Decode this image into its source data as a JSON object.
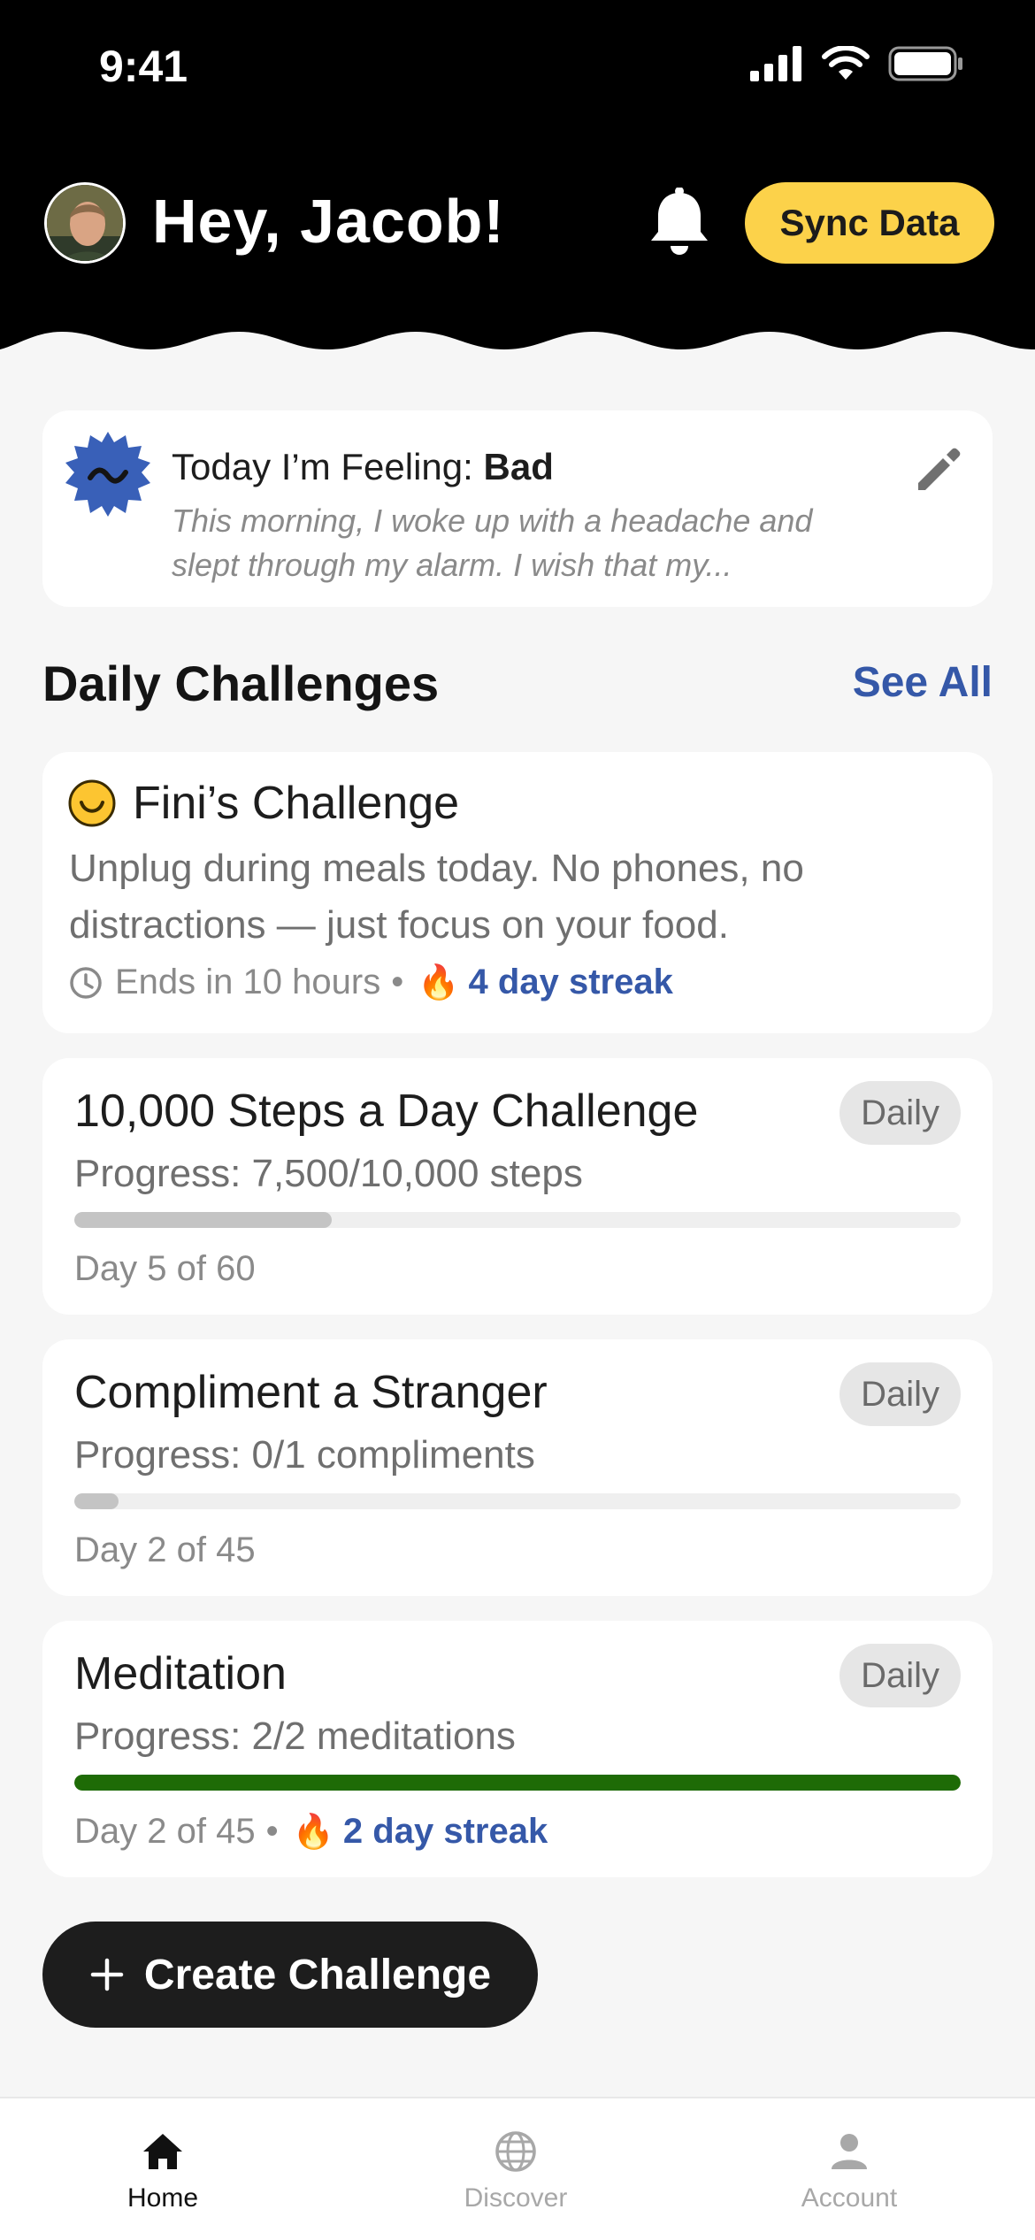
{
  "status_bar": {
    "time": "9:41"
  },
  "header": {
    "greeting": "Hey, Jacob!",
    "sync_label": "Sync Data"
  },
  "feeling": {
    "prefix": "Today I’m Feeling: ",
    "mood": "Bad",
    "note": "This morning, I woke up with a headache and slept through my alarm. I wish that my..."
  },
  "challenges": {
    "section_title": "Daily Challenges",
    "see_all": "See All",
    "fini": {
      "title": "Fini’s Challenge",
      "description": "Unplug during meals today. No phones, no distractions — just focus on your food.",
      "ends": "Ends in 10 hours",
      "streak": "4 day streak"
    },
    "items": [
      {
        "title": "10,000 Steps a Day Challenge",
        "badge": "Daily",
        "progress_text": "Progress: 7,500/10,000 steps",
        "progress": 0.29,
        "day": "Day 5 of 60",
        "streak": ""
      },
      {
        "title": "Compliment a Stranger",
        "badge": "Daily",
        "progress_text": "Progress: 0/1 compliments",
        "progress": 0.05,
        "day": "Day 2 of 45",
        "streak": ""
      },
      {
        "title": "Meditation",
        "badge": "Daily",
        "progress_text": "Progress: 2/2 meditations",
        "progress": 1.0,
        "day": "Day 2 of 45",
        "streak": "2 day streak"
      }
    ]
  },
  "create_label": "Create Challenge",
  "nav": [
    {
      "label": "Home",
      "icon": "home-icon",
      "active": true
    },
    {
      "label": "Discover",
      "icon": "globe-icon",
      "active": false
    },
    {
      "label": "Account",
      "icon": "person-icon",
      "active": false
    }
  ],
  "colors": {
    "accent_yellow": "#fcd24a",
    "link_blue": "#3558a8",
    "complete_green": "#1e6b06",
    "header_black": "#000000"
  }
}
